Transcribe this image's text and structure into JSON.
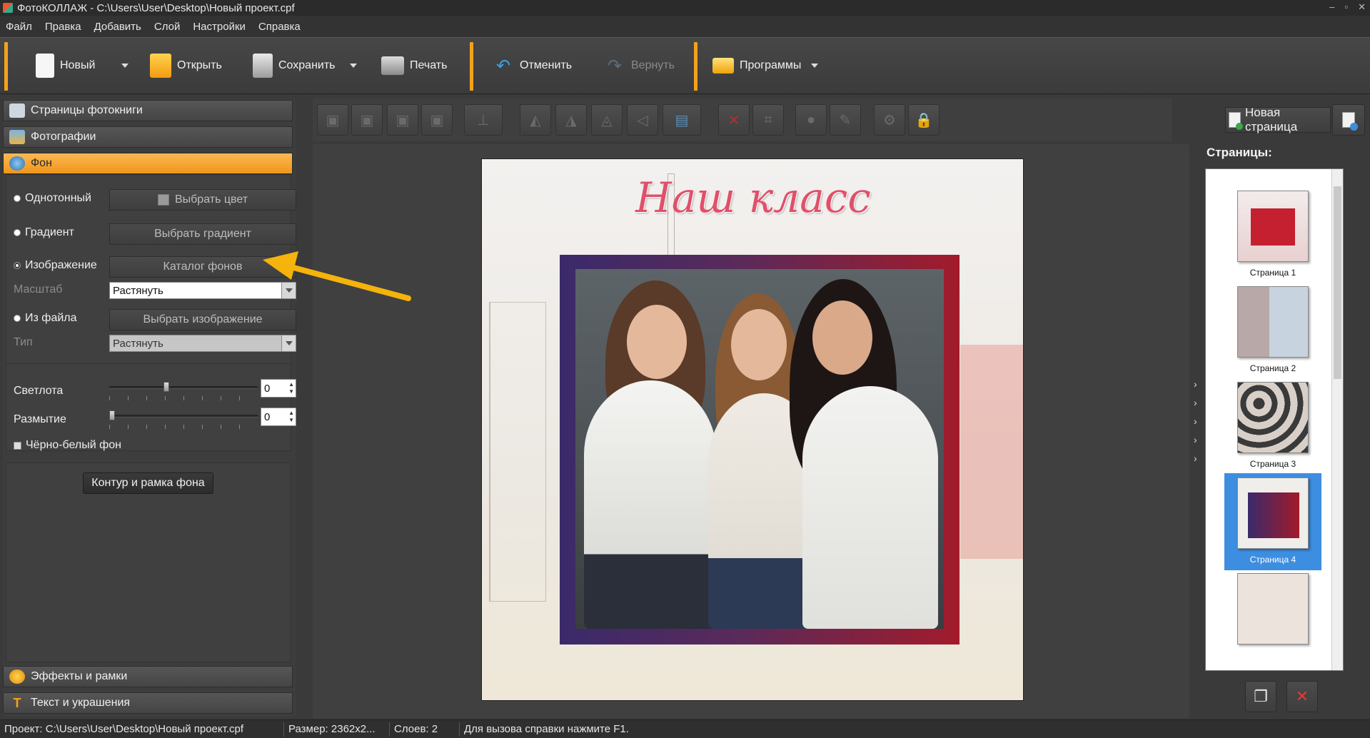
{
  "window": {
    "title": "ФотоКОЛЛАЖ - C:\\Users\\User\\Desktop\\Новый проект.cpf",
    "controls": [
      "–",
      "▫",
      "✕"
    ]
  },
  "menu": [
    "Файл",
    "Правка",
    "Добавить",
    "Слой",
    "Настройки",
    "Справка"
  ],
  "toolbar": {
    "new_label": "Новый",
    "open_label": "Открыть",
    "save_label": "Сохранить",
    "print_label": "Печать",
    "undo_label": "Отменить",
    "redo_label": "Вернуть",
    "programs_label": "Программы"
  },
  "left_panel": {
    "sections": {
      "pages": "Страницы фотокниги",
      "photos": "Фотографии",
      "background": "Фон",
      "effects": "Эффекты и рамки",
      "text": "Текст и украшения"
    },
    "background": {
      "solid_label": "Однотонный",
      "choose_color": "Выбрать цвет",
      "gradient_label": "Градиент",
      "choose_gradient": "Выбрать градиент",
      "image_label": "Изображение",
      "catalog": "Каталог фонов",
      "scale_label": "Масштаб",
      "scale_value": "Растянуть",
      "from_file_label": "Из файла",
      "choose_image": "Выбрать изображение",
      "type_label": "Тип",
      "type_value": "Растянуть",
      "brightness_label": "Светлота",
      "brightness_value": "0",
      "brightness_level": 0.38,
      "blur_label": "Размытие",
      "blur_value": "0",
      "blur_level": 0.0,
      "bw_label": "Чёрно-белый фон",
      "contour_btn": "Контур и рамка фона",
      "selected_option": "image"
    }
  },
  "right_panel": {
    "new_page_label": "Новая страница",
    "pages_label": "Страницы:",
    "pages": [
      {
        "label": "Страница 1",
        "selected": false
      },
      {
        "label": "Страница 2",
        "selected": false
      },
      {
        "label": "Страница 3",
        "selected": false
      },
      {
        "label": "Страница 4",
        "selected": true
      }
    ]
  },
  "canvas": {
    "title_text": "Наш класс"
  },
  "statusbar": {
    "project": "Проект:  C:\\Users\\User\\Desktop\\Новый проект.cpf",
    "size": "Размер:  2362x2...",
    "layers": "Слоев:  2",
    "hint": "Для вызова справки нажмите F1."
  },
  "colors": {
    "accent": "#f2a21b",
    "selection": "#3d8ee0",
    "title_pink": "#e0506a",
    "arrow": "#f5b30c"
  }
}
